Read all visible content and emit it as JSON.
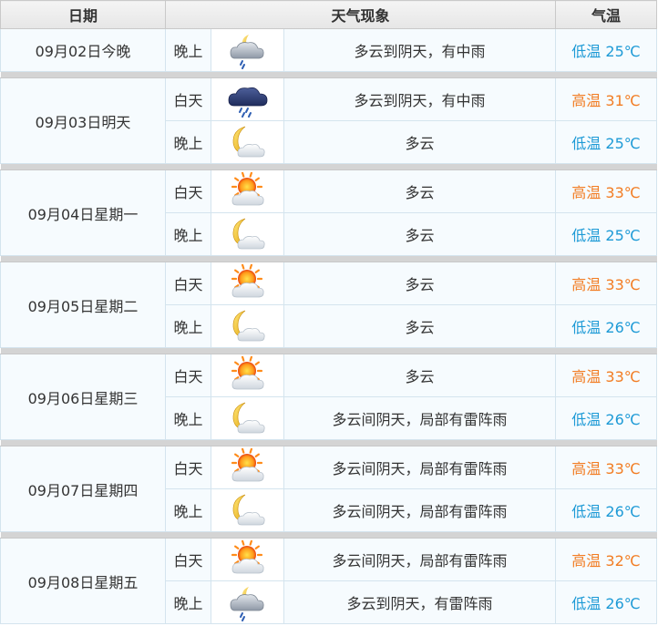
{
  "headers": {
    "date": "日期",
    "weather": "天气现象",
    "temp": "气温"
  },
  "days": [
    {
      "date": "09月02日今晚",
      "periods": [
        {
          "period": "晚上",
          "icon": "rain-cloud-icon",
          "desc": "多云到阴天，有中雨",
          "temp_label": "低温",
          "temp": "25℃",
          "kind": "low"
        }
      ]
    },
    {
      "date": "09月03日明天",
      "periods": [
        {
          "period": "白天",
          "icon": "dark-rain-cloud-icon",
          "desc": "多云到阴天，有中雨",
          "temp_label": "高温",
          "temp": "31℃",
          "kind": "high"
        },
        {
          "period": "晚上",
          "icon": "moon-cloud-icon",
          "desc": "多云",
          "temp_label": "低温",
          "temp": "25℃",
          "kind": "low"
        }
      ]
    },
    {
      "date": "09月04日星期一",
      "periods": [
        {
          "period": "白天",
          "icon": "sun-cloud-icon",
          "desc": "多云",
          "temp_label": "高温",
          "temp": "33℃",
          "kind": "high"
        },
        {
          "period": "晚上",
          "icon": "moon-cloud-icon",
          "desc": "多云",
          "temp_label": "低温",
          "temp": "25℃",
          "kind": "low"
        }
      ]
    },
    {
      "date": "09月05日星期二",
      "periods": [
        {
          "period": "白天",
          "icon": "sun-cloud-icon",
          "desc": "多云",
          "temp_label": "高温",
          "temp": "33℃",
          "kind": "high"
        },
        {
          "period": "晚上",
          "icon": "moon-cloud-icon",
          "desc": "多云",
          "temp_label": "低温",
          "temp": "26℃",
          "kind": "low"
        }
      ]
    },
    {
      "date": "09月06日星期三",
      "periods": [
        {
          "period": "白天",
          "icon": "sun-cloud-icon",
          "desc": "多云",
          "temp_label": "高温",
          "temp": "33℃",
          "kind": "high"
        },
        {
          "period": "晚上",
          "icon": "moon-cloud-icon",
          "desc": "多云间阴天，局部有雷阵雨",
          "temp_label": "低温",
          "temp": "26℃",
          "kind": "low"
        }
      ]
    },
    {
      "date": "09月07日星期四",
      "periods": [
        {
          "period": "白天",
          "icon": "sun-cloud-icon",
          "desc": "多云间阴天，局部有雷阵雨",
          "temp_label": "高温",
          "temp": "33℃",
          "kind": "high"
        },
        {
          "period": "晚上",
          "icon": "moon-cloud-icon",
          "desc": "多云间阴天，局部有雷阵雨",
          "temp_label": "低温",
          "temp": "26℃",
          "kind": "low"
        }
      ]
    },
    {
      "date": "09月08日星期五",
      "periods": [
        {
          "period": "白天",
          "icon": "sun-cloud-icon",
          "desc": "多云间阴天，局部有雷阵雨",
          "temp_label": "高温",
          "temp": "32℃",
          "kind": "high"
        },
        {
          "period": "晚上",
          "icon": "rain-cloud-icon",
          "desc": "多云到阴天，有雷阵雨",
          "temp_label": "低温",
          "temp": "26℃",
          "kind": "low"
        }
      ]
    }
  ],
  "colors": {
    "high": "#f27c22",
    "low": "#1d9ad6",
    "separator": "#d4d4d4",
    "cell_bg": "#f6fbfe"
  }
}
